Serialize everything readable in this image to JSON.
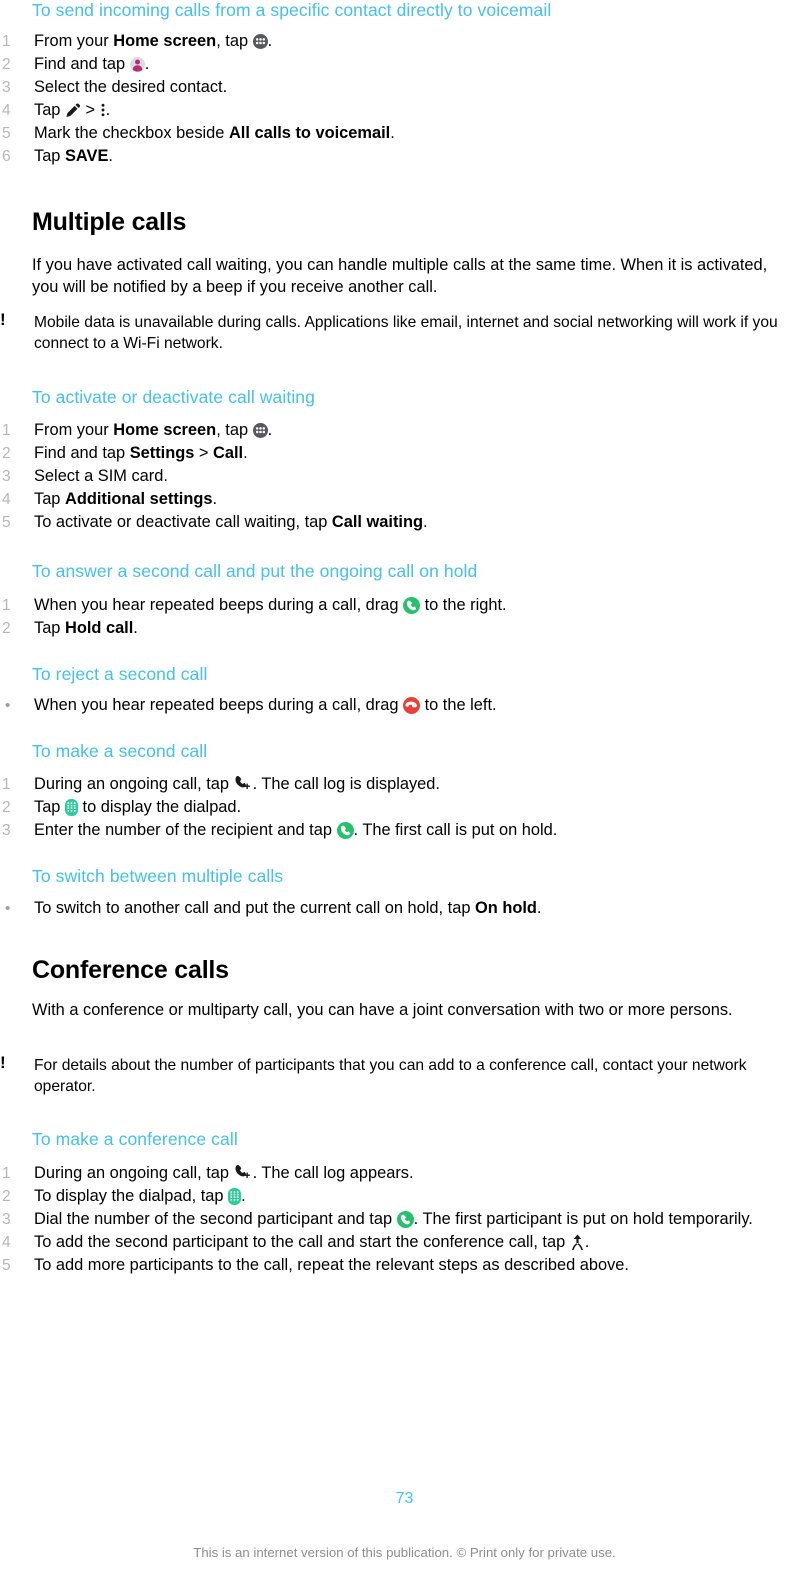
{
  "document": {
    "page_number": "73",
    "footer_note": "This is an internet version of this publication. © Print only for private use.",
    "accent_color": "#44c0ea",
    "answer_icon_color": "#25c16c",
    "reject_icon_color": "#e8413c",
    "dialpad_icon_color": "#2ecb9a",
    "contacts_icon_color": "#b32d7f"
  },
  "sections": [
    {
      "id": "voicemail-procedure",
      "heading": "To send incoming calls from a specific contact directly to voicemail",
      "steps": [
        {
          "parts": [
            {
              "t": "From your "
            },
            {
              "t": "Home screen",
              "b": true
            },
            {
              "t": ", tap "
            },
            {
              "icon": "app-drawer-icon"
            },
            {
              "t": "."
            }
          ]
        },
        {
          "parts": [
            {
              "t": "Find and tap "
            },
            {
              "icon": "contacts-icon"
            },
            {
              "t": "."
            }
          ]
        },
        {
          "parts": [
            {
              "t": "Select the desired contact."
            }
          ]
        },
        {
          "parts": [
            {
              "t": "Tap "
            },
            {
              "icon": "pencil-icon"
            },
            {
              "t": " > "
            },
            {
              "icon": "overflow-menu-icon"
            },
            {
              "t": "."
            }
          ]
        },
        {
          "parts": [
            {
              "t": "Mark the checkbox beside "
            },
            {
              "t": "All calls to voicemail",
              "b": true
            },
            {
              "t": "."
            }
          ]
        },
        {
          "parts": [
            {
              "t": "Tap "
            },
            {
              "t": "SAVE",
              "b": true
            },
            {
              "t": "."
            }
          ]
        }
      ]
    },
    {
      "id": "multiple-calls",
      "title": "Multiple calls",
      "paragraph": "If you have activated call waiting, you can handle multiple calls at the same time. When it is activated, you will be notified by a beep if you receive another call.",
      "note": "Mobile data is unavailable during calls. Applications like email, internet and social networking will work if you connect to a Wi-Fi network.",
      "note_marker": "!"
    },
    {
      "id": "activate-call-waiting",
      "heading": "To activate or deactivate call waiting",
      "steps": [
        {
          "parts": [
            {
              "t": "From your "
            },
            {
              "t": "Home screen",
              "b": true
            },
            {
              "t": ", tap "
            },
            {
              "icon": "app-drawer-icon"
            },
            {
              "t": "."
            }
          ]
        },
        {
          "parts": [
            {
              "t": "Find and tap "
            },
            {
              "t": "Settings",
              "b": true
            },
            {
              "t": " > "
            },
            {
              "t": "Call",
              "b": true
            },
            {
              "t": "."
            }
          ]
        },
        {
          "parts": [
            {
              "t": "Select a SIM card."
            }
          ]
        },
        {
          "parts": [
            {
              "t": "Tap "
            },
            {
              "t": "Additional settings",
              "b": true
            },
            {
              "t": "."
            }
          ]
        },
        {
          "parts": [
            {
              "t": "To activate or deactivate call waiting, tap "
            },
            {
              "t": "Call waiting",
              "b": true
            },
            {
              "t": "."
            }
          ]
        }
      ]
    },
    {
      "id": "answer-second-call",
      "heading": "To answer a second call and put the ongoing call on hold",
      "steps": [
        {
          "parts": [
            {
              "t": "When you hear repeated beeps during a call, drag "
            },
            {
              "icon": "answer-call-icon"
            },
            {
              "t": " to the right."
            }
          ]
        },
        {
          "parts": [
            {
              "t": "Tap "
            },
            {
              "t": "Hold call",
              "b": true
            },
            {
              "t": "."
            }
          ]
        }
      ]
    },
    {
      "id": "reject-second-call",
      "heading": "To reject a second call",
      "bullets": [
        {
          "parts": [
            {
              "t": "When you hear repeated beeps during a call, drag "
            },
            {
              "icon": "reject-call-icon"
            },
            {
              "t": " to the left."
            }
          ]
        }
      ]
    },
    {
      "id": "make-second-call",
      "heading": "To make a second call",
      "steps": [
        {
          "parts": [
            {
              "t": "During an ongoing call, tap "
            },
            {
              "icon": "add-call-icon"
            },
            {
              "t": ". The call log is displayed."
            }
          ]
        },
        {
          "parts": [
            {
              "t": "Tap "
            },
            {
              "icon": "dialpad-icon"
            },
            {
              "t": " to display the dialpad."
            }
          ]
        },
        {
          "parts": [
            {
              "t": "Enter the number of the recipient and tap "
            },
            {
              "icon": "answer-call-icon"
            },
            {
              "t": ". The first call is put on hold."
            }
          ]
        }
      ]
    },
    {
      "id": "switch-multiple-calls",
      "heading": "To switch between multiple calls",
      "bullets": [
        {
          "parts": [
            {
              "t": "To switch to another call and put the current call on hold, tap "
            },
            {
              "t": "On hold",
              "b": true
            },
            {
              "t": "."
            }
          ]
        }
      ]
    },
    {
      "id": "conference-calls",
      "title": "Conference calls",
      "paragraph": "With a conference or multiparty call, you can have a joint conversation with two or more persons.",
      "note": "For details about the number of participants that you can add to a conference call, contact your network operator.",
      "note_marker": "!"
    },
    {
      "id": "make-conference-call",
      "heading": "To make a conference call",
      "steps": [
        {
          "parts": [
            {
              "t": "During an ongoing call, tap "
            },
            {
              "icon": "add-call-icon"
            },
            {
              "t": ". The call log appears."
            }
          ]
        },
        {
          "parts": [
            {
              "t": "To display the dialpad, tap "
            },
            {
              "icon": "dialpad-icon"
            },
            {
              "t": "."
            }
          ]
        },
        {
          "parts": [
            {
              "t": "Dial the number of the second participant and tap "
            },
            {
              "icon": "answer-call-icon"
            },
            {
              "t": ". The first participant is put on hold temporarily."
            }
          ]
        },
        {
          "parts": [
            {
              "t": "To add the second participant to the call and start the conference call, tap "
            },
            {
              "icon": "merge-call-icon"
            },
            {
              "t": "."
            }
          ]
        },
        {
          "parts": [
            {
              "t": "To add more participants to the call, repeat the relevant steps as described above."
            }
          ]
        }
      ]
    }
  ]
}
